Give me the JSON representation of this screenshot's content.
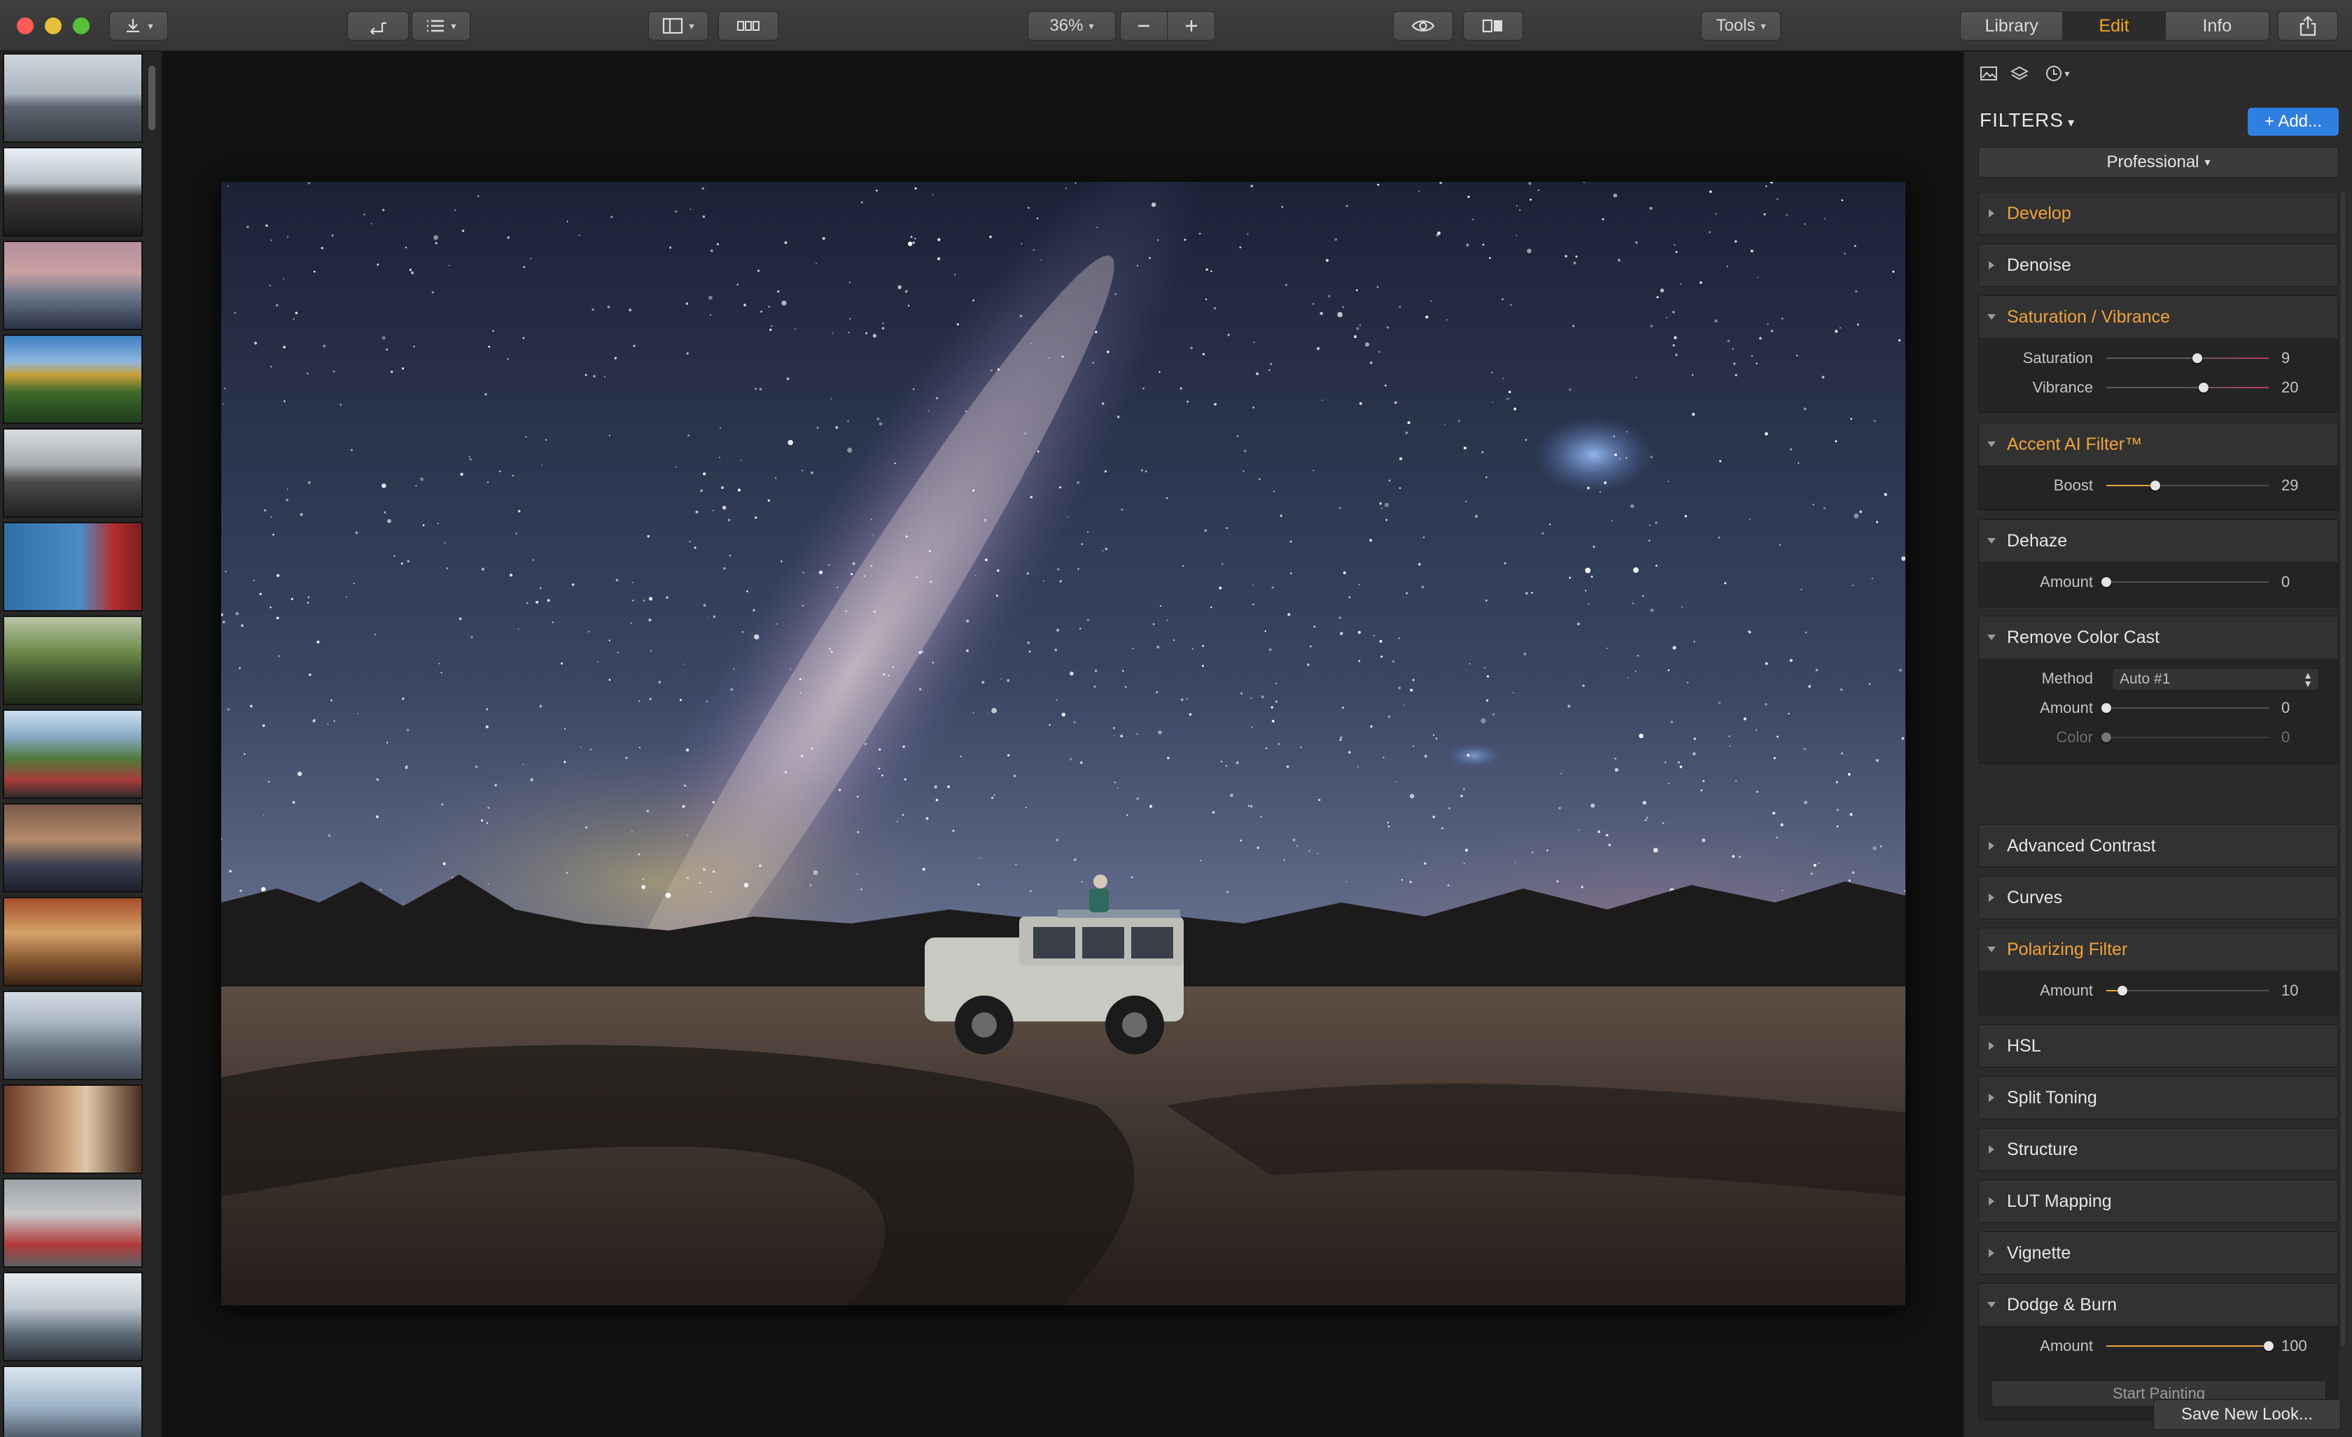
{
  "toolbar": {
    "zoom": "36%",
    "tools_label": "Tools",
    "tabs": [
      {
        "label": "Library",
        "active": false
      },
      {
        "label": "Edit",
        "active": true
      },
      {
        "label": "Info",
        "active": false
      }
    ]
  },
  "panel": {
    "filters_title": "FILTERS",
    "add_label": "+ Add...",
    "preset": "Professional",
    "save_label": "Save New Look...",
    "sections": {
      "develop": {
        "title": "Develop"
      },
      "denoise": {
        "title": "Denoise"
      },
      "saturation": {
        "title": "Saturation / Vibrance",
        "rows": [
          {
            "label": "Saturation",
            "value": "9"
          },
          {
            "label": "Vibrance",
            "value": "20"
          }
        ]
      },
      "accent": {
        "title": "Accent AI Filter™",
        "rows": [
          {
            "label": "Boost",
            "value": "29"
          }
        ]
      },
      "dehaze": {
        "title": "Dehaze",
        "rows": [
          {
            "label": "Amount",
            "value": "0"
          }
        ]
      },
      "colorcast": {
        "title": "Remove Color Cast",
        "method_label": "Method",
        "method_value": "Auto #1",
        "rows": [
          {
            "label": "Amount",
            "value": "0"
          },
          {
            "label": "Color",
            "value": "0"
          }
        ]
      },
      "contrast": {
        "title": "Advanced Contrast"
      },
      "curves": {
        "title": "Curves"
      },
      "polarizing": {
        "title": "Polarizing Filter",
        "rows": [
          {
            "label": "Amount",
            "value": "10"
          }
        ]
      },
      "hsl": {
        "title": "HSL"
      },
      "split": {
        "title": "Split Toning"
      },
      "structure": {
        "title": "Structure"
      },
      "lut": {
        "title": "LUT Mapping"
      },
      "vignette": {
        "title": "Vignette"
      },
      "dodge": {
        "title": "Dodge & Burn",
        "rows": [
          {
            "label": "Amount",
            "value": "100"
          }
        ],
        "button": "Start Painting"
      }
    }
  },
  "slider_levels": {
    "saturation": 0.56,
    "vibrance": 0.6,
    "boost": 0.3,
    "dehaze": 0.0,
    "cast_amount": 0.0,
    "cast_color": 0.0,
    "polarizing": 0.1,
    "dodge": 1.0
  },
  "colors": {
    "accent": "#f0a33b",
    "blue_button": "#2f7fe0",
    "active_tab_text": "#f4a523"
  },
  "icons": [
    "download-icon",
    "back-icon",
    "sort-icon",
    "sidebar-icon",
    "grid-icon",
    "zoom-out-icon",
    "zoom-in-icon",
    "eye-icon",
    "compare-icon",
    "share-icon",
    "image-icon",
    "layers-icon",
    "history-icon"
  ]
}
